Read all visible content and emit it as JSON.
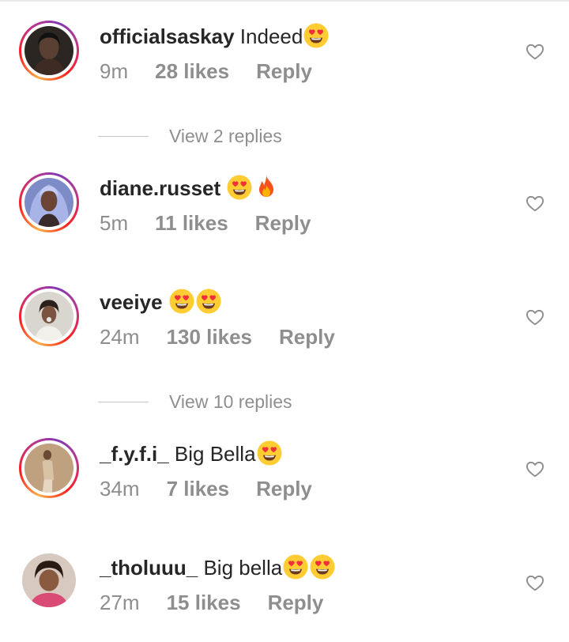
{
  "comments": [
    {
      "username": "officialsaskay",
      "text": "Indeed",
      "emojis": [
        "heart-eyes"
      ],
      "time": "9m",
      "likes": "28 likes",
      "reply": "Reply",
      "story_ring": true
    },
    {
      "username": "diane.russet",
      "text": "",
      "emojis": [
        "heart-eyes",
        "fire"
      ],
      "time": "5m",
      "likes": "11 likes",
      "reply": "Reply",
      "story_ring": true
    },
    {
      "username": "veeiye",
      "text": "",
      "emojis": [
        "heart-eyes",
        "heart-eyes"
      ],
      "time": "24m",
      "likes": "130 likes",
      "reply": "Reply",
      "story_ring": true
    },
    {
      "username": "_f.y.f.i_",
      "text": "Big Bella",
      "emojis": [
        "heart-eyes"
      ],
      "time": "34m",
      "likes": "7 likes",
      "reply": "Reply",
      "story_ring": true
    },
    {
      "username": "_tholuuu_",
      "text": "Big bella",
      "emojis": [
        "heart-eyes",
        "heart-eyes"
      ],
      "time": "27m",
      "likes": "15 likes",
      "reply": "Reply",
      "story_ring": false
    }
  ],
  "view_replies": [
    {
      "label": "View 2 replies"
    },
    {
      "label": "View 10 replies"
    }
  ],
  "icons": {
    "like": "heart-outline-icon",
    "emoji_heart_eyes": "smiling-face-with-heart-eyes-emoji",
    "emoji_fire": "fire-emoji"
  },
  "colors": {
    "text": "#262626",
    "secondary": "#8e8e8e",
    "divider": "#c7c7c7",
    "emoji_face": "#ffcc33",
    "emoji_heart": "#f0303a",
    "fire_outer": "#f4511e",
    "fire_inner": "#ffb300"
  }
}
